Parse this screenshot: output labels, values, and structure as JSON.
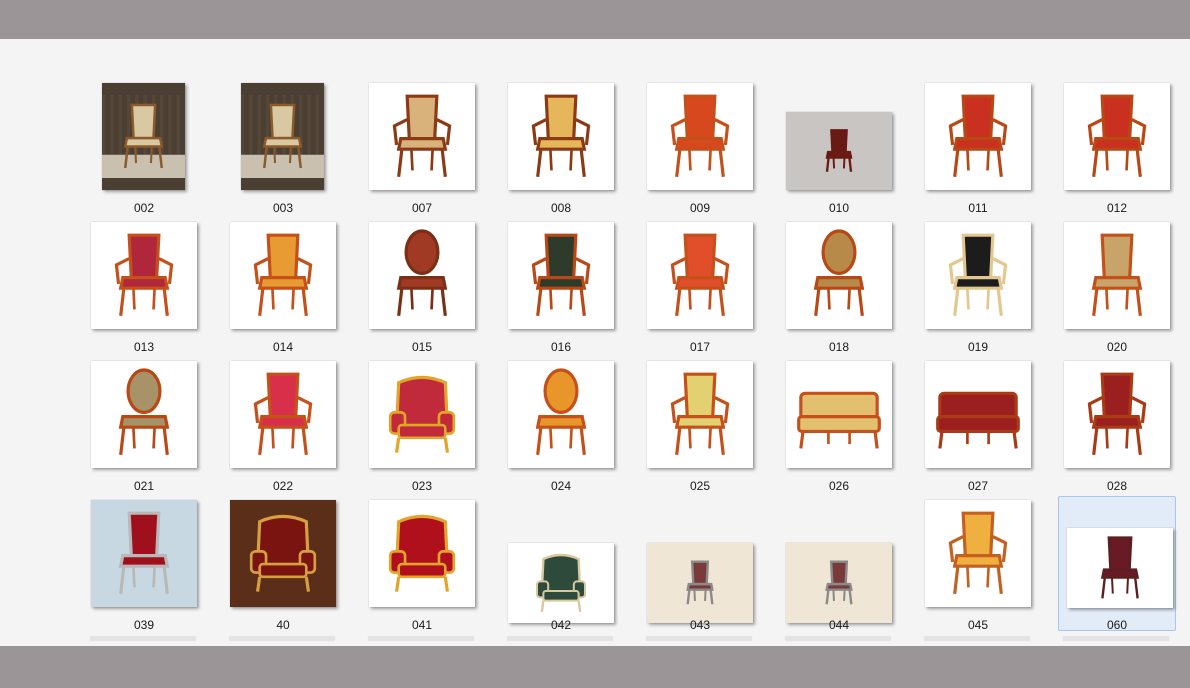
{
  "window": {
    "title": ""
  },
  "gallery": {
    "items": [
      {
        "label": "002",
        "icon": "chair-thumbnail-icon",
        "bg": "#4b3f34",
        "accent": "#8a5a2c",
        "seat": "#d9c9a3",
        "style": "room"
      },
      {
        "label": "003",
        "icon": "chair-thumbnail-icon",
        "bg": "#4b3f34",
        "accent": "#8a5a2c",
        "seat": "#d9c9a3",
        "style": "room"
      },
      {
        "label": "007",
        "icon": "chair-thumbnail-icon",
        "bg": "#ffffff",
        "accent": "#8b3a16",
        "seat": "#d8b27a",
        "style": "arm"
      },
      {
        "label": "008",
        "icon": "chair-thumbnail-icon",
        "bg": "#ffffff",
        "accent": "#8b3a16",
        "seat": "#e5b75a",
        "style": "arm"
      },
      {
        "label": "009",
        "icon": "chair-thumbnail-icon",
        "bg": "#ffffff",
        "accent": "#c4501a",
        "seat": "#d8481f",
        "style": "arm"
      },
      {
        "label": "010",
        "icon": "chair-thumbnail-icon",
        "bg": "#c9c5c3",
        "accent": "#6a1a14",
        "seat": "#6a1a14",
        "style": "small"
      },
      {
        "label": "011",
        "icon": "chair-thumbnail-icon",
        "bg": "#ffffff",
        "accent": "#b84815",
        "seat": "#c9301f",
        "style": "arm"
      },
      {
        "label": "012",
        "icon": "chair-thumbnail-icon",
        "bg": "#ffffff",
        "accent": "#b84815",
        "seat": "#c9301f",
        "style": "arm"
      },
      {
        "label": "013",
        "icon": "chair-thumbnail-icon",
        "bg": "#ffffff",
        "accent": "#c4501a",
        "seat": "#b0263b",
        "style": "arm"
      },
      {
        "label": "014",
        "icon": "chair-thumbnail-icon",
        "bg": "#ffffff",
        "accent": "#c4501a",
        "seat": "#e89a33",
        "style": "arm"
      },
      {
        "label": "015",
        "icon": "chair-thumbnail-icon",
        "bg": "#ffffff",
        "accent": "#7a3015",
        "seat": "#a03a25",
        "style": "oval"
      },
      {
        "label": "016",
        "icon": "chair-thumbnail-icon",
        "bg": "#ffffff",
        "accent": "#b84815",
        "seat": "#2e3a2a",
        "style": "arm"
      },
      {
        "label": "017",
        "icon": "chair-thumbnail-icon",
        "bg": "#ffffff",
        "accent": "#c4501a",
        "seat": "#e04e2a",
        "style": "arm"
      },
      {
        "label": "018",
        "icon": "chair-thumbnail-icon",
        "bg": "#ffffff",
        "accent": "#b84815",
        "seat": "#b88a4a",
        "style": "oval"
      },
      {
        "label": "019",
        "icon": "chair-thumbnail-icon",
        "bg": "#ffffff",
        "accent": "#e2c88f",
        "seat": "#1c1c1c",
        "style": "arm"
      },
      {
        "label": "020",
        "icon": "chair-thumbnail-icon",
        "bg": "#ffffff",
        "accent": "#c4501a",
        "seat": "#c9a46a",
        "style": "side"
      },
      {
        "label": "021",
        "icon": "chair-thumbnail-icon",
        "bg": "#ffffff",
        "accent": "#b84815",
        "seat": "#a89268",
        "style": "oval"
      },
      {
        "label": "022",
        "icon": "chair-thumbnail-icon",
        "bg": "#ffffff",
        "accent": "#c4501a",
        "seat": "#d8304a",
        "style": "arm"
      },
      {
        "label": "023",
        "icon": "chair-thumbnail-icon",
        "bg": "#ffffff",
        "accent": "#e2a52a",
        "seat": "#c02a3a",
        "style": "wing"
      },
      {
        "label": "024",
        "icon": "chair-thumbnail-icon",
        "bg": "#ffffff",
        "accent": "#c4501a",
        "seat": "#e8962a",
        "style": "oval"
      },
      {
        "label": "025",
        "icon": "chair-thumbnail-icon",
        "bg": "#ffffff",
        "accent": "#c4501a",
        "seat": "#e3d070",
        "style": "arm"
      },
      {
        "label": "026",
        "icon": "chair-thumbnail-icon",
        "bg": "#ffffff",
        "accent": "#c4501a",
        "seat": "#e3c070",
        "style": "sofa"
      },
      {
        "label": "027",
        "icon": "chair-thumbnail-icon",
        "bg": "#ffffff",
        "accent": "#a83a15",
        "seat": "#9c1f1f",
        "style": "sofa"
      },
      {
        "label": "028",
        "icon": "chair-thumbnail-icon",
        "bg": "#ffffff",
        "accent": "#a83a15",
        "seat": "#9c1f1f",
        "style": "arm"
      },
      {
        "label": "039",
        "icon": "chair-thumbnail-icon",
        "bg": "#c8d8e2",
        "accent": "#b8b8b8",
        "seat": "#a0101c",
        "style": "side"
      },
      {
        "label": "40",
        "icon": "chair-thumbnail-icon",
        "bg": "#5a2e18",
        "accent": "#d6a040",
        "seat": "#7a1410",
        "style": "wing"
      },
      {
        "label": "041",
        "icon": "chair-thumbnail-icon",
        "bg": "#ffffff",
        "accent": "#e2a52a",
        "seat": "#b0101c",
        "style": "wing"
      },
      {
        "label": "042",
        "icon": "chair-thumbnail-icon",
        "bg": "#ffffff",
        "accent": "#d8c8a0",
        "seat": "#2e4a3a",
        "style": "wing"
      },
      {
        "label": "043",
        "icon": "chair-thumbnail-icon",
        "bg": "#efe6d6",
        "accent": "#8a8a8a",
        "seat": "#7a3a3a",
        "style": "small"
      },
      {
        "label": "044",
        "icon": "chair-thumbnail-icon",
        "bg": "#efe6d6",
        "accent": "#8a8a8a",
        "seat": "#7a3a3a",
        "style": "small"
      },
      {
        "label": "045",
        "icon": "chair-thumbnail-icon",
        "bg": "#ffffff",
        "accent": "#c46020",
        "seat": "#f0b040",
        "style": "arm"
      },
      {
        "label": "060",
        "icon": "chair-thumbnail-icon",
        "bg": "#ffffff",
        "accent": "#5a2020",
        "seat": "#6a1a24",
        "style": "side",
        "selected": true
      }
    ]
  },
  "colors": {
    "frame": "#9c9598",
    "panel": "#f5f4f4",
    "selection": "#e2ecf8",
    "selection_border": "#a9c5e8"
  }
}
